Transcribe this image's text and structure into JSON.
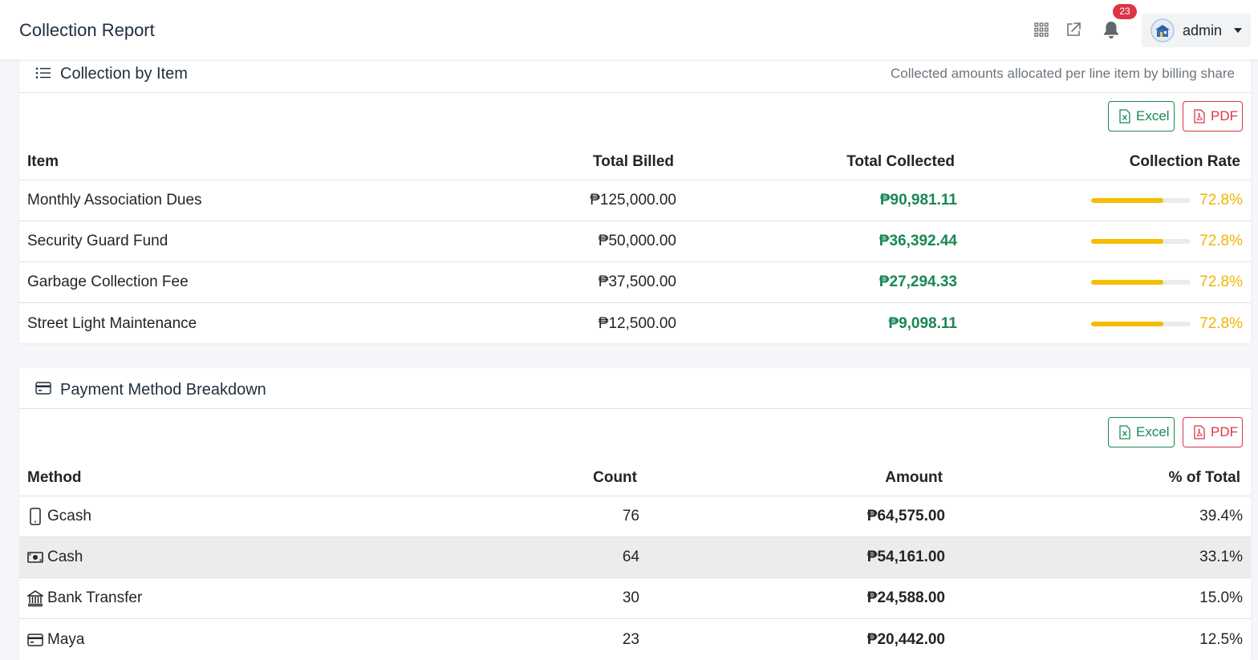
{
  "header": {
    "title": "Collection Report",
    "notification_count": "23",
    "user_name": "admin"
  },
  "collection_by_item": {
    "title": "Collection by Item",
    "subtitle": "Collected amounts allocated per line item by billing share",
    "excel_label": "Excel",
    "pdf_label": "PDF",
    "columns": [
      "Item",
      "Total Billed",
      "Total Collected",
      "Collection Rate"
    ],
    "rows": [
      {
        "item": "Monthly Association Dues",
        "billed": "₱125,000.00",
        "collected": "₱90,981.11",
        "rate": "72.8%",
        "rate_value": 0.728
      },
      {
        "item": "Security Guard Fund",
        "billed": "₱50,000.00",
        "collected": "₱36,392.44",
        "rate": "72.8%",
        "rate_value": 0.728
      },
      {
        "item": "Garbage Collection Fee",
        "billed": "₱37,500.00",
        "collected": "₱27,294.33",
        "rate": "72.8%",
        "rate_value": 0.728
      },
      {
        "item": "Street Light Maintenance",
        "billed": "₱12,500.00",
        "collected": "₱9,098.11",
        "rate": "72.8%",
        "rate_value": 0.728
      }
    ]
  },
  "payment_methods": {
    "title": "Payment Method Breakdown",
    "excel_label": "Excel",
    "pdf_label": "PDF",
    "columns": [
      "Method",
      "Count",
      "Amount",
      "% of Total"
    ],
    "rows": [
      {
        "method": "Gcash",
        "icon": "phone-icon",
        "count": "76",
        "amount": "₱64,575.00",
        "share": "39.4%"
      },
      {
        "method": "Cash",
        "icon": "cash-icon",
        "count": "64",
        "amount": "₱54,161.00",
        "share": "33.1%"
      },
      {
        "method": "Bank Transfer",
        "icon": "bank-icon",
        "count": "30",
        "amount": "₱24,588.00",
        "share": "15.0%"
      },
      {
        "method": "Maya",
        "icon": "card-icon",
        "count": "23",
        "amount": "₱20,442.00",
        "share": "12.5%"
      }
    ]
  },
  "colors": {
    "accent_green": "#198754",
    "accent_red": "#dc3545",
    "rate_yellow": "#f5bd00"
  }
}
